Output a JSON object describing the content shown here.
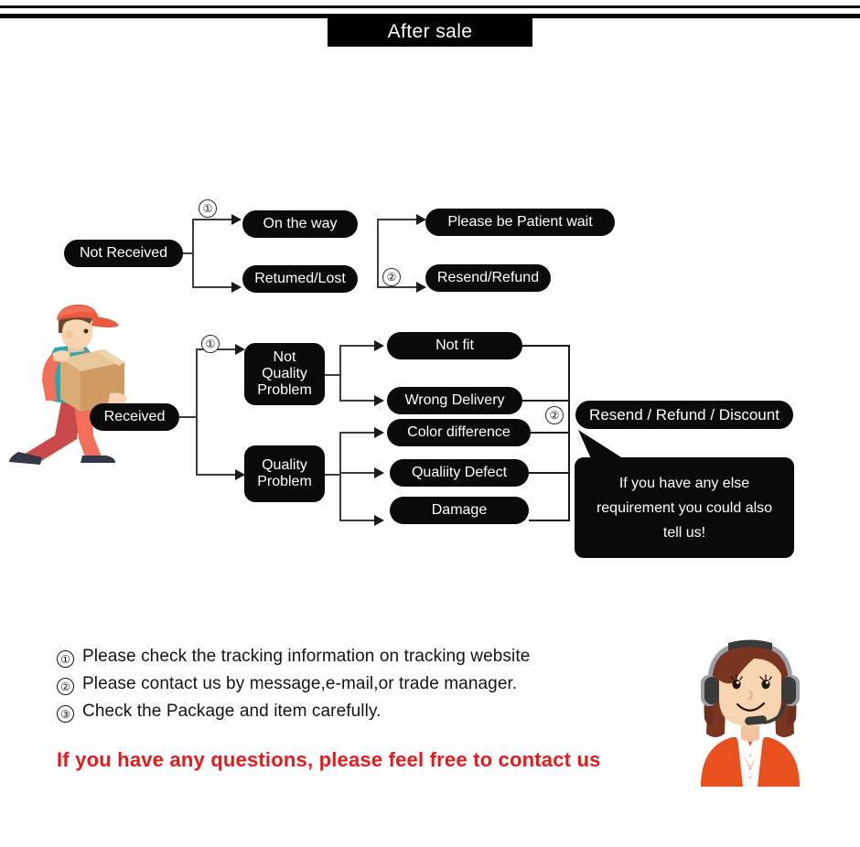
{
  "header": {
    "title": "After sale"
  },
  "flow": {
    "not_received": {
      "label": "Not Received",
      "marker_1": "①",
      "branches": [
        {
          "label": "On the way"
        },
        {
          "label": "Retumed/Lost"
        }
      ],
      "marker_2": "②",
      "outcomes": [
        {
          "label": "Please be Patient wait"
        },
        {
          "label": "Resend/Refund"
        }
      ]
    },
    "received": {
      "label": "Received",
      "marker_1": "①",
      "categories": [
        {
          "label": "Not\nQuality\nProblem"
        },
        {
          "label": "Quality\nProblem"
        }
      ],
      "not_quality_reasons": [
        {
          "label": "Not fit"
        },
        {
          "label": "Wrong Delivery"
        }
      ],
      "quality_reasons": [
        {
          "label": "Color difference"
        },
        {
          "label": "Qualiity Defect"
        },
        {
          "label": "Damage"
        }
      ],
      "marker_2": "②",
      "resolution": "Resend / Refund / Discount",
      "bubble": "If you have any else requirement you could also tell us!"
    }
  },
  "notes": [
    {
      "num": "①",
      "text": "Please check the tracking information on tracking website"
    },
    {
      "num": "②",
      "text": "Please contact us by message,e-mail,or trade manager."
    },
    {
      "num": "③",
      "text": "Check the Package and item carefully."
    }
  ],
  "tagline": "If you have any questions, please feel free to contact us",
  "illustrations": {
    "courier": "delivery-man-carrying-box-illustration",
    "agent": "customer-service-woman-headset-illustration"
  },
  "colors": {
    "pill_background": "#0a0a0a",
    "pill_text": "#ffffff",
    "tagline_red": "#e8191b",
    "connector": "#3c3c3c",
    "courier_cap": "#ea5a3d",
    "courier_shirt": "#2fa5ad",
    "courier_sleeve": "#f2705a",
    "courier_pants": "#f2705a",
    "courier_pants_back": "#c84a4a",
    "courier_box": "#dbab76",
    "courier_box_top": "#e8c79c",
    "courier_skin": "#f7d5b0",
    "courier_hair": "#6b4a30",
    "agent_hair": "#7a3520",
    "agent_skin": "#f7d5b0",
    "agent_cardigan": "#e8501e",
    "agent_shirt": "#ffffff",
    "agent_headset": "#3a3a3a"
  }
}
